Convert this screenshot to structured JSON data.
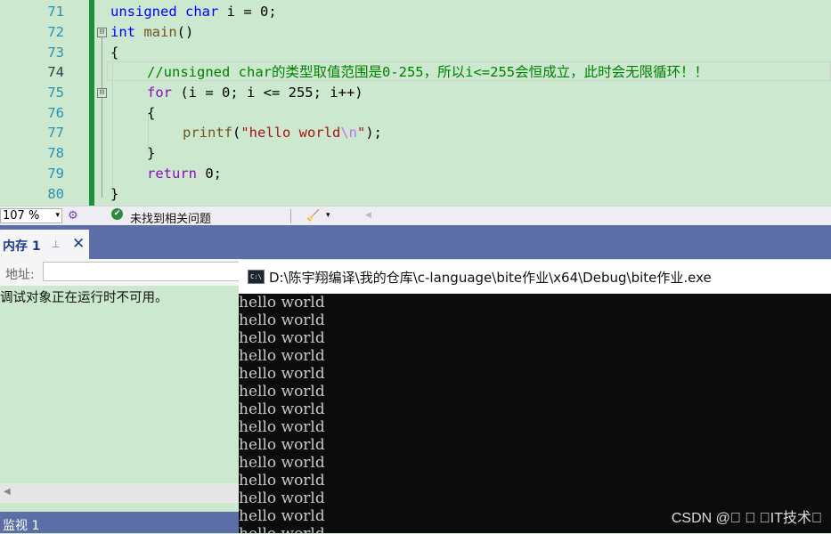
{
  "editor": {
    "line_numbers": [
      "71",
      "72",
      "73",
      "74",
      "75",
      "76",
      "77",
      "78",
      "79",
      "80"
    ],
    "lines": {
      "l71": {
        "k1": "unsigned",
        "sp1": " ",
        "k2": "char",
        "rest": " i = 0;"
      },
      "l72": {
        "k1": "int",
        "sp": " ",
        "fn": "main",
        "rest": "()"
      },
      "l73": {
        "text": "{"
      },
      "l74": {
        "comment": "//unsigned char的类型取值范围是0-255，所以i<=255会恒成立，此时会无限循环！！"
      },
      "l75": {
        "kw": "for",
        "rest": " (i = 0; i <= 255; i++)"
      },
      "l76": {
        "text": "{"
      },
      "l77": {
        "fn": "printf",
        "p1": "(",
        "s1": "\"hello world",
        "esc": "\\n",
        "s2": "\"",
        "p2": ");"
      },
      "l78": {
        "text": "}"
      },
      "l79": {
        "kw": "return",
        "rest": " 0;"
      },
      "l80": {
        "text": "}"
      }
    },
    "fold_markers": [
      "⊟",
      "⊟"
    ]
  },
  "statusbar": {
    "zoom": "107 %",
    "zoom_arrow": "▾",
    "issues_text": "未找到相关问题",
    "check_icon": "✔",
    "copilot_icon": "⚙",
    "brush_icon": "🧹",
    "brush_arrow": "▾",
    "scroll_left": "◀"
  },
  "memory_panel": {
    "tab_label": "内存 1",
    "pin_icon": "⊥",
    "close_icon": "✕",
    "address_label": "地址:",
    "address_value": "",
    "message": "调试对象正在运行时不可用。",
    "scroll_left": "◀"
  },
  "watch_panel": {
    "tab_label": "监视 1"
  },
  "console": {
    "icon_text": "C:\\",
    "title": "D:\\陈宇翔编译\\我的仓库\\c-language\\bite作业\\x64\\Debug\\bite作业.exe",
    "output_lines": [
      "hello world",
      "hello world",
      "hello world",
      "hello world",
      "hello world",
      "hello world",
      "hello world",
      "hello world",
      "hello world",
      "hello world",
      "hello world",
      "hello world",
      "hello world",
      "hello world"
    ]
  },
  "watermark": "CSDN @\u0000 \u0000 \u0000IT技术\u0000",
  "colors": {
    "editor_bg": "#cce8cf",
    "accent_blue": "#5b6fa6",
    "console_bg": "#0c0c0c",
    "change_bar": "#1e8f3a"
  }
}
